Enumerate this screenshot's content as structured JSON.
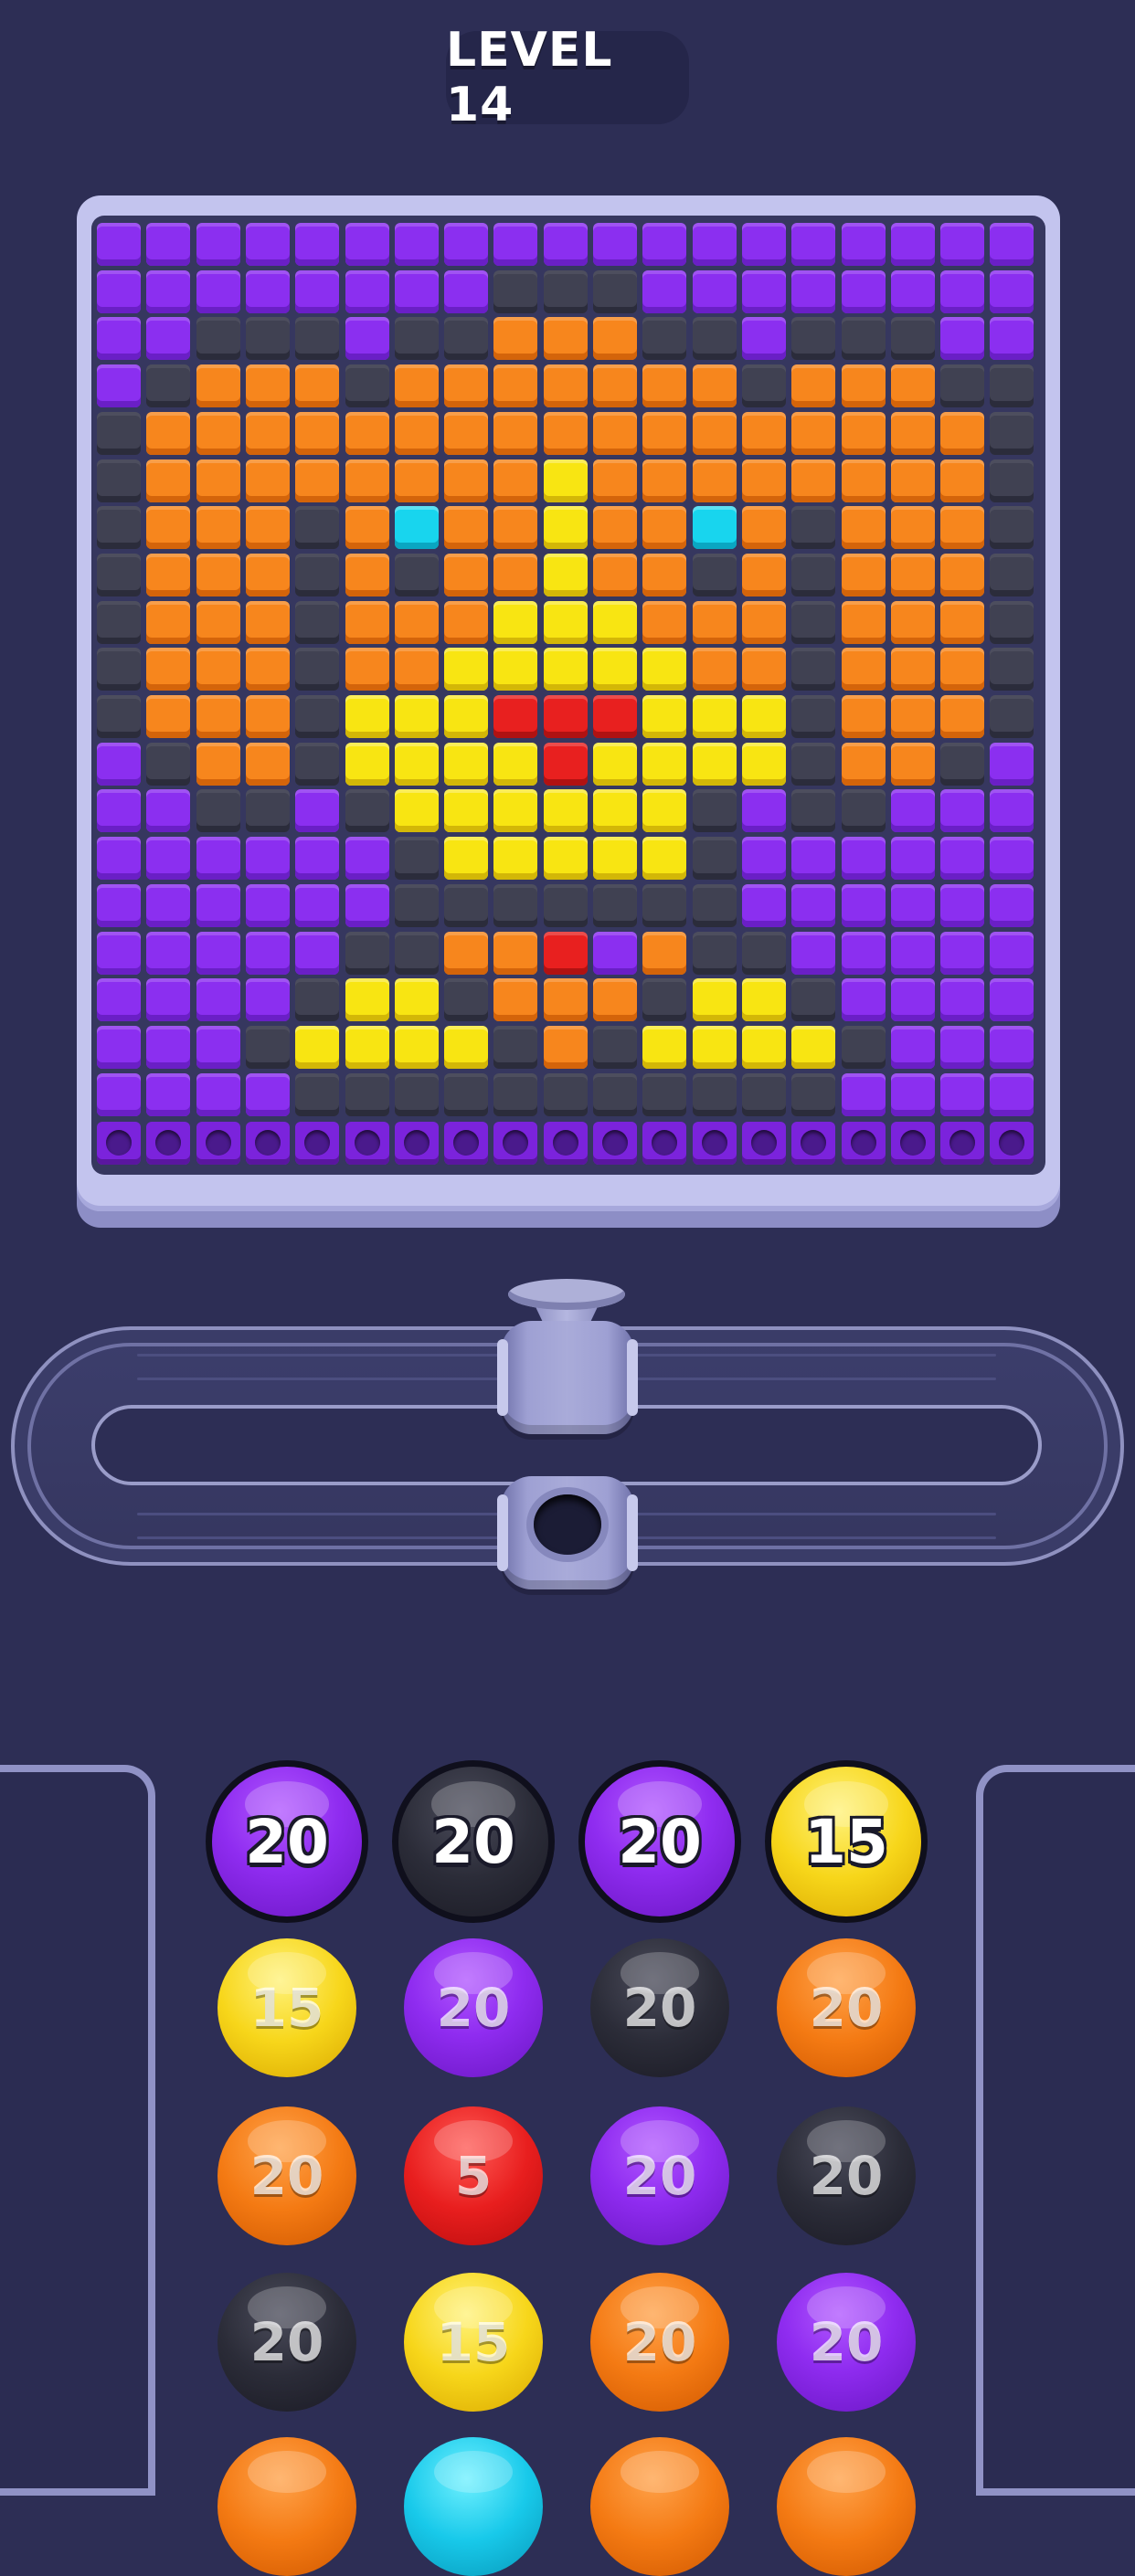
{
  "level": {
    "label": "LEVEL 14"
  },
  "colors": {
    "P": "#8b2ff0",
    "K": "#404152",
    "O": "#f7861d",
    "Y": "#f8e512",
    "R": "#e8201f",
    "C": "#18d5ee"
  },
  "board": {
    "columns": 19,
    "rows": [
      "PPPPPPPPPPPPPPPPPPP",
      "PPPPPPPPKKKPPPPPPPP",
      "PPKKKPKKOOOKKPKKKPP",
      "PKOOOKOOOOOOOKOOOKK",
      "KOOOOOOOOOOOOOOOOOK",
      "KOOOOOOOOYOOOOOOOOK",
      "KOOOKOCOOYOOCOKOOOK",
      "KOOOKOKOOYOOKOKOOOK",
      "KOOOKOOOYYYOOOKOOOK",
      "KOOOKOOYYYYYOOKOOOK",
      "KOOOKYYYRRRYYYKOOOK",
      "PKOOKYYYYRYYYYKOOKP",
      "PPKKPKYYYYYYKPKKPPP",
      "PPPPPPKYYYYYKPPPPPP",
      "PPPPPPKKKKKKKPPPPPP",
      "PPPPPKKOORPOKKPPPPP",
      "PPPPKYYKOOOKYYKPPPP",
      "PPPKYYYYKOKYYYYKPPP",
      "PPPPKKKKKKKKKKKPPPP"
    ],
    "slot_count": 19
  },
  "balls": [
    [
      {
        "color": "purple",
        "count": "20",
        "front": true
      },
      {
        "color": "black",
        "count": "20",
        "front": true
      },
      {
        "color": "purple",
        "count": "20",
        "front": true
      },
      {
        "color": "yellow",
        "count": "15",
        "front": true
      }
    ],
    [
      {
        "color": "yellow",
        "count": "15",
        "front": false
      },
      {
        "color": "purple",
        "count": "20",
        "front": false
      },
      {
        "color": "black",
        "count": "20",
        "front": false
      },
      {
        "color": "orange",
        "count": "20",
        "front": false
      }
    ],
    [
      {
        "color": "orange",
        "count": "20",
        "front": false
      },
      {
        "color": "red",
        "count": "5",
        "front": false
      },
      {
        "color": "purple",
        "count": "20",
        "front": false
      },
      {
        "color": "black",
        "count": "20",
        "front": false
      }
    ],
    [
      {
        "color": "black",
        "count": "20",
        "front": false
      },
      {
        "color": "yellow",
        "count": "15",
        "front": false
      },
      {
        "color": "orange",
        "count": "20",
        "front": false
      },
      {
        "color": "purple",
        "count": "20",
        "front": false
      }
    ],
    [
      {
        "color": "orange",
        "count": "",
        "front": false
      },
      {
        "color": "cyan",
        "count": "",
        "front": false
      },
      {
        "color": "orange",
        "count": "",
        "front": false
      },
      {
        "color": "orange",
        "count": "",
        "front": false
      }
    ]
  ]
}
